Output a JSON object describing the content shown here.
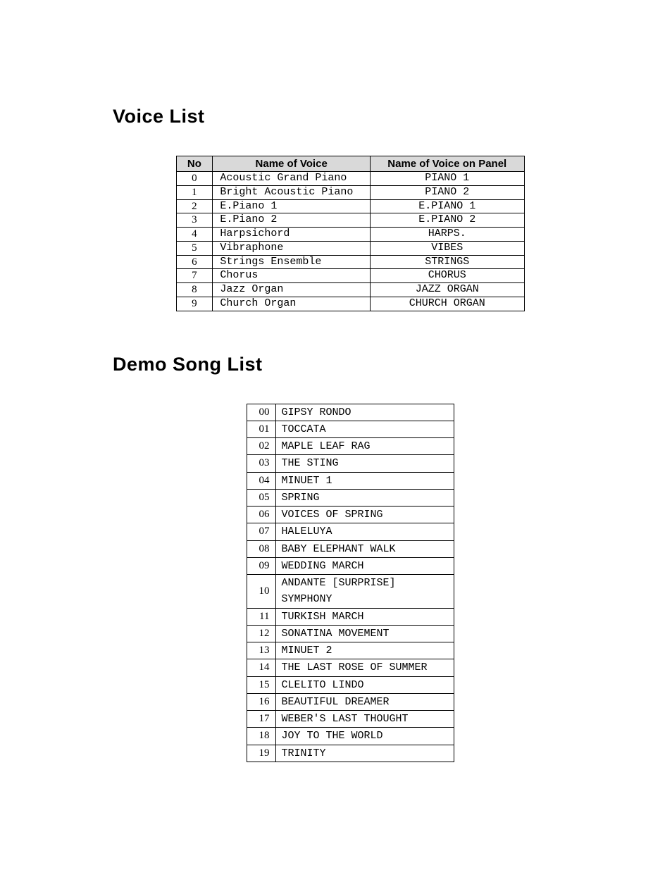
{
  "headings": {
    "voice_list": "Voice List",
    "demo_song_list": "Demo Song List"
  },
  "voice_table": {
    "headers": {
      "no": "No",
      "name": "Name of Voice",
      "panel": "Name of Voice on Panel"
    },
    "rows": [
      {
        "no": "0",
        "name": "Acoustic Grand Piano",
        "panel": "PIANO 1"
      },
      {
        "no": "1",
        "name": "Bright Acoustic Piano",
        "panel": "PIANO 2"
      },
      {
        "no": "2",
        "name": "E.Piano 1",
        "panel": "E.PIANO 1"
      },
      {
        "no": "3",
        "name": "E.Piano 2",
        "panel": "E.PIANO 2"
      },
      {
        "no": "4",
        "name": "Harpsichord",
        "panel": "HARPS."
      },
      {
        "no": "5",
        "name": "Vibraphone",
        "panel": "VIBES"
      },
      {
        "no": "6",
        "name": "Strings Ensemble",
        "panel": "STRINGS"
      },
      {
        "no": "7",
        "name": "Chorus",
        "panel": "CHORUS"
      },
      {
        "no": "8",
        "name": "Jazz Organ",
        "panel": "JAZZ ORGAN"
      },
      {
        "no": "9",
        "name": "Church Organ",
        "panel": "CHURCH ORGAN"
      }
    ]
  },
  "song_table": {
    "rows": [
      {
        "no": "00",
        "name": "GIPSY RONDO"
      },
      {
        "no": "01",
        "name": "TOCCATA"
      },
      {
        "no": "02",
        "name": "MAPLE LEAF RAG"
      },
      {
        "no": "03",
        "name": "THE STING"
      },
      {
        "no": "04",
        "name": "MINUET 1"
      },
      {
        "no": "05",
        "name": "SPRING"
      },
      {
        "no": "06",
        "name": "VOICES OF SPRING"
      },
      {
        "no": "07",
        "name": "HALELUYA"
      },
      {
        "no": "08",
        "name": "BABY ELEPHANT WALK"
      },
      {
        "no": "09",
        "name": "WEDDING MARCH"
      },
      {
        "no": "10",
        "name": "ANDANTE [SURPRISE] SYMPHONY"
      },
      {
        "no": "11",
        "name": "TURKISH MARCH"
      },
      {
        "no": "12",
        "name": "SONATINA MOVEMENT"
      },
      {
        "no": "13",
        "name": "MINUET 2"
      },
      {
        "no": "14",
        "name": "THE LAST ROSE OF SUMMER"
      },
      {
        "no": "15",
        "name": "CLELITO LINDO"
      },
      {
        "no": "16",
        "name": "BEAUTIFUL DREAMER"
      },
      {
        "no": "17",
        "name": "WEBER'S LAST THOUGHT"
      },
      {
        "no": "18",
        "name": "JOY TO THE WORLD"
      },
      {
        "no": "19",
        "name": "TRINITY"
      }
    ]
  }
}
